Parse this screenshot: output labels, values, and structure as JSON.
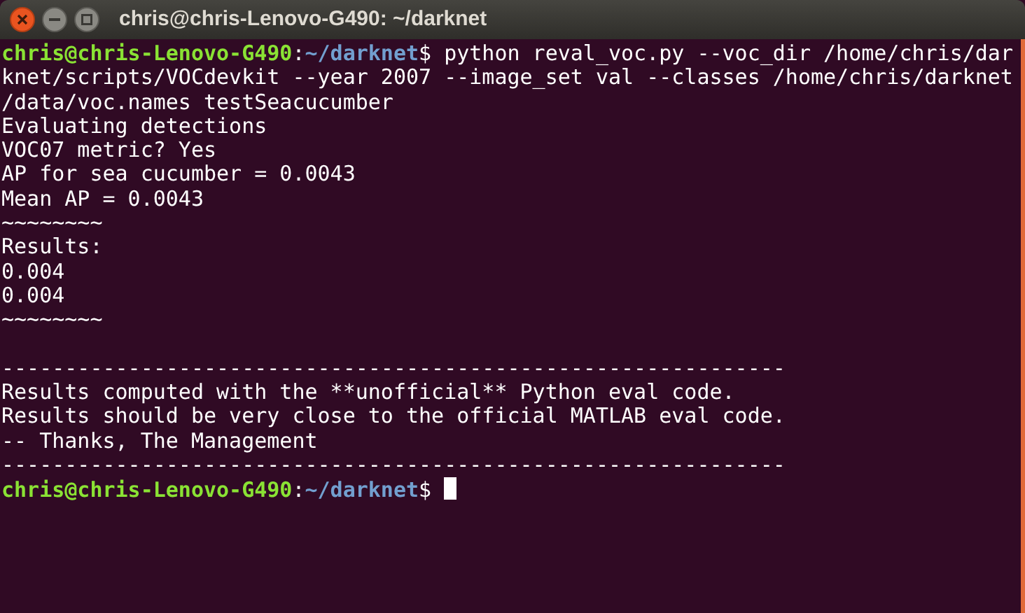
{
  "window": {
    "title": "chris@chris-Lenovo-G490: ~/darknet"
  },
  "lines": [
    {
      "kind": "prompt",
      "user_host": "chris@chris-Lenovo-G490",
      "colon": ":",
      "path": "~/darknet",
      "symbol": "$",
      "command": " python reval_voc.py --voc_dir /home/chris/dar"
    },
    {
      "kind": "output",
      "text": "knet/scripts/VOCdevkit --year 2007 --image_set val --classes /home/chris/darknet"
    },
    {
      "kind": "output",
      "text": "/data/voc.names testSeacucumber"
    },
    {
      "kind": "output",
      "text": "Evaluating detections"
    },
    {
      "kind": "output",
      "text": "VOC07 metric? Yes"
    },
    {
      "kind": "output",
      "text": "AP for sea cucumber = 0.0043"
    },
    {
      "kind": "output",
      "text": "Mean AP = 0.0043"
    },
    {
      "kind": "output",
      "text": "~~~~~~~~"
    },
    {
      "kind": "output",
      "text": "Results:"
    },
    {
      "kind": "output",
      "text": "0.004"
    },
    {
      "kind": "output",
      "text": "0.004"
    },
    {
      "kind": "output",
      "text": "~~~~~~~~"
    },
    {
      "kind": "blank"
    },
    {
      "kind": "output",
      "text": "--------------------------------------------------------------"
    },
    {
      "kind": "output",
      "text": "Results computed with the **unofficial** Python eval code."
    },
    {
      "kind": "output",
      "text": "Results should be very close to the official MATLAB eval code."
    },
    {
      "kind": "output",
      "text": "-- Thanks, The Management"
    },
    {
      "kind": "output",
      "text": "--------------------------------------------------------------"
    },
    {
      "kind": "prompt",
      "user_host": "chris@chris-Lenovo-G490",
      "colon": ":",
      "path": "~/darknet",
      "symbol": "$",
      "cursor": true
    }
  ]
}
